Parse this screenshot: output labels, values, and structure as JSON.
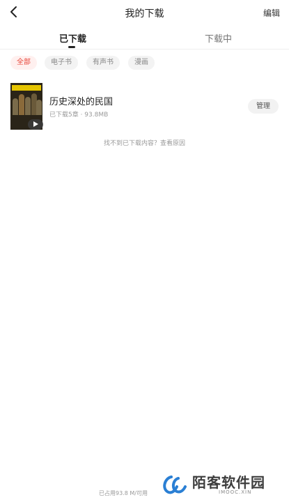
{
  "header": {
    "title": "我的下载",
    "edit_label": "编辑"
  },
  "tabs": [
    {
      "label": "已下载",
      "active": true
    },
    {
      "label": "下载中",
      "active": false
    }
  ],
  "filters": [
    {
      "label": "全部",
      "active": true
    },
    {
      "label": "电子书",
      "active": false
    },
    {
      "label": "有声书",
      "active": false
    },
    {
      "label": "漫画",
      "active": false
    }
  ],
  "downloads": [
    {
      "title": "历史深处的民国",
      "meta": "已下载5章 · 93.8MB",
      "manage_label": "管理",
      "cover_icon": "play-icon"
    }
  ],
  "hint": "找不到已下载内容？查看原因",
  "footer": "已占用93.8 M/可用",
  "watermark": {
    "text": "陌客软件园",
    "sub": "IMOOC.XIN"
  },
  "colors": {
    "accent": "#e8473b",
    "chip_bg": "#f3f3f3"
  }
}
